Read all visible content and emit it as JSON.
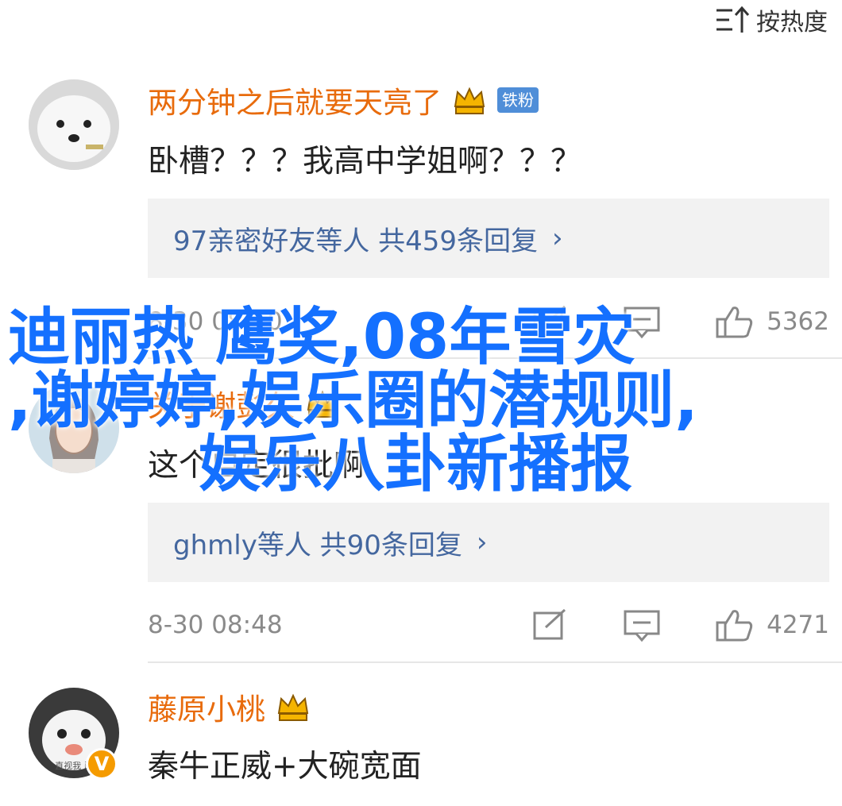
{
  "sort": {
    "label": "按热度",
    "icon": "sort-icon"
  },
  "comments": [
    {
      "user": "两分钟之后就要天亮了",
      "fan_badge": "铁粉",
      "text": "卧槽？？？我高中学姐啊？？？",
      "reply_summary": "97亲密好友等人 共459条回复",
      "time": "8-30 08:50",
      "likes": "5362"
    },
    {
      "user": "关于谢彭久",
      "text": "这个自定很批啊",
      "reply_summary": "ghmly等人 共90条回复",
      "time": "8-30 08:48",
      "likes": "4271"
    },
    {
      "user": "藤原小桃",
      "avatar_caption": "直视我 忍",
      "text": "秦牛正威+大碗宽面"
    }
  ],
  "overlay": {
    "line1": "迪丽热 鹰奖,08年雪灾",
    "line2": ",谢婷婷,娱乐圈的潜规则,",
    "line3": "娱乐八卦新播报"
  },
  "colors": {
    "username": "#e86b0c",
    "reply_link": "#44679f",
    "overlay": "#1470ff",
    "fan_badge": "#4f8ed8"
  }
}
